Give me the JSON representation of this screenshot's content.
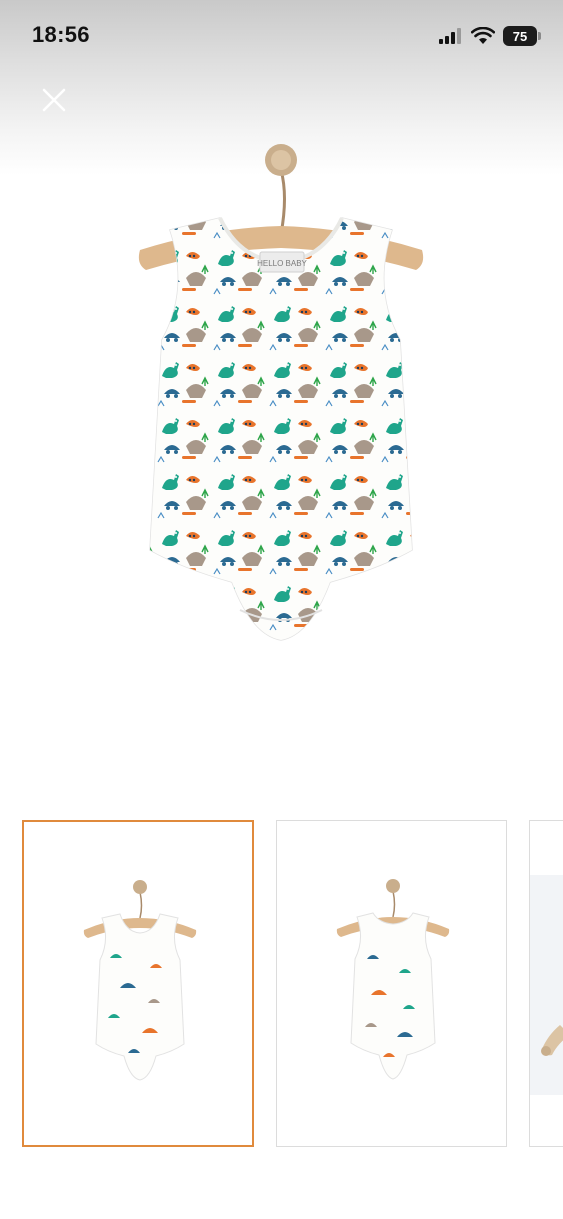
{
  "status_bar": {
    "time": "18:56",
    "battery": "75"
  },
  "close_button": {
    "icon": "close-icon"
  },
  "product": {
    "main_image": "baby-bodysuit-dinosaur-print",
    "label_text": "HELLO BABY"
  },
  "gallery": {
    "selected_index": 0,
    "thumbnails": [
      {
        "image": "bodysuit-front-view",
        "selected": true
      },
      {
        "image": "bodysuit-back-view",
        "selected": false
      },
      {
        "image": "hanger-detail",
        "selected": false
      }
    ]
  },
  "colors": {
    "accent": "#e08a3c",
    "border": "#dcdcdc"
  }
}
